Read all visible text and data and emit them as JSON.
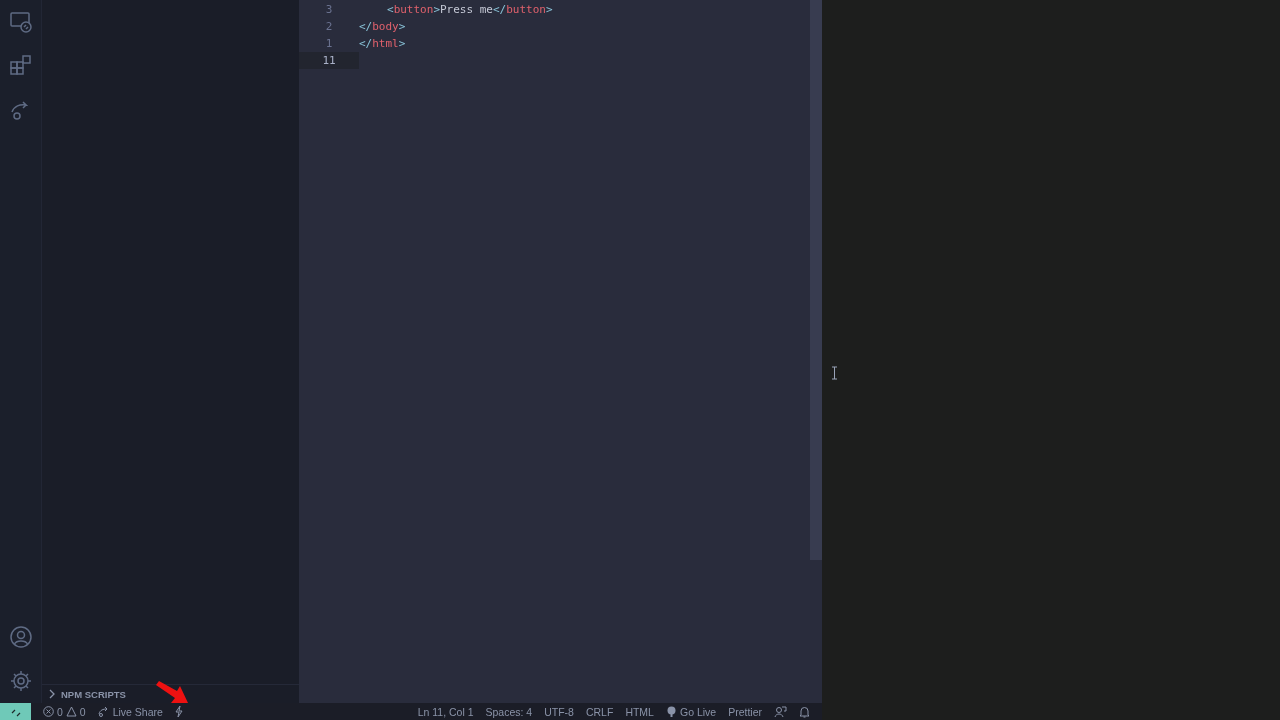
{
  "sidebar": {
    "section": {
      "label": "NPM SCRIPTS",
      "expanded": false
    }
  },
  "editor": {
    "lines": [
      {
        "number": "3",
        "indent": true,
        "current": false,
        "tokens": [
          {
            "kind": "bracket",
            "text": "<"
          },
          {
            "kind": "tag",
            "text": "button"
          },
          {
            "kind": "bracket",
            "text": ">"
          },
          {
            "kind": "text",
            "text": "Press me"
          },
          {
            "kind": "bracket",
            "text": "</"
          },
          {
            "kind": "tag",
            "text": "button"
          },
          {
            "kind": "bracket",
            "text": ">"
          }
        ]
      },
      {
        "number": "2",
        "indent": false,
        "current": false,
        "tokens": [
          {
            "kind": "bracket",
            "text": "</"
          },
          {
            "kind": "tag",
            "text": "body"
          },
          {
            "kind": "bracket",
            "text": ">"
          }
        ]
      },
      {
        "number": "1",
        "indent": false,
        "current": false,
        "tokens": [
          {
            "kind": "bracket",
            "text": "</"
          },
          {
            "kind": "tag",
            "text": "html"
          },
          {
            "kind": "bracket",
            "text": ">"
          }
        ]
      },
      {
        "number": "11",
        "current": true
      }
    ]
  },
  "status_bar": {
    "errors": "0",
    "warnings": "0",
    "live_share": "Live Share",
    "right": [
      "Ln 11, Col 1",
      "Spaces: 4",
      "UTF-8",
      "CRLF",
      "HTML"
    ],
    "go_live": "Go Live",
    "formatter": "Prettier"
  }
}
